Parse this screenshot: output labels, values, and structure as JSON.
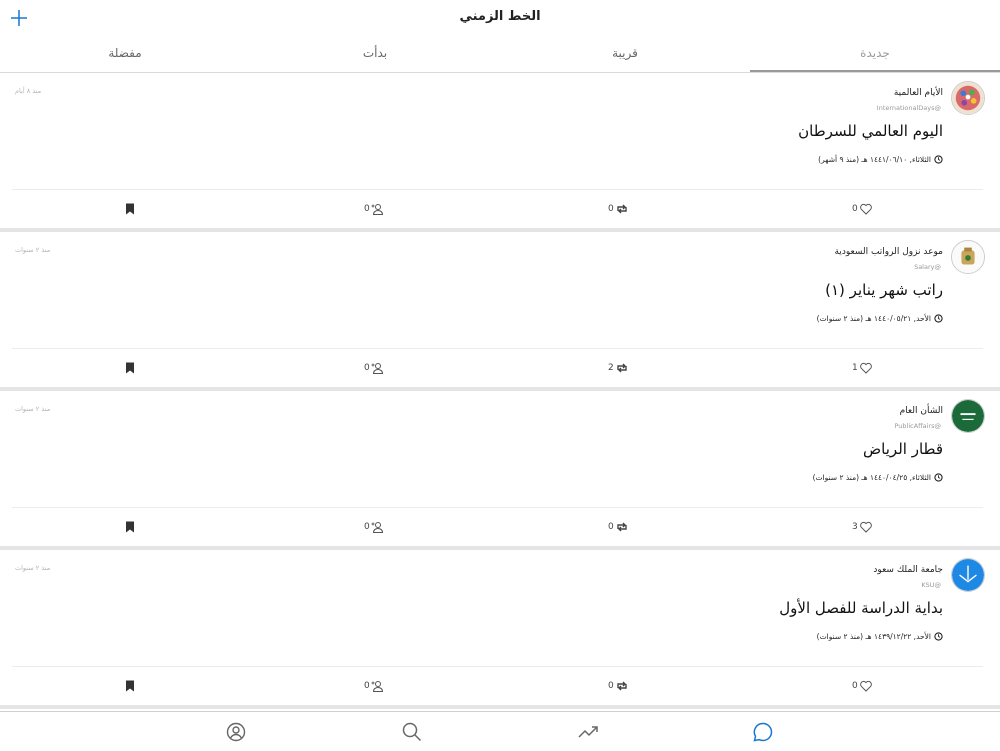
{
  "header": {
    "title": "الخط الزمني",
    "add_icon": "plus-icon"
  },
  "tabs": [
    {
      "label": "جديدة",
      "active": true
    },
    {
      "label": "قريبة",
      "active": false
    },
    {
      "label": "بدأت",
      "active": false
    },
    {
      "label": "مفضلة",
      "active": false
    }
  ],
  "cards": [
    {
      "author": "الأيام العالمية",
      "handle": "InternationalDays@",
      "time_ago": "منذ ٨ أيام",
      "headline": "اليوم العالمي للسرطان",
      "date": "الثلاثاء, ١٤٤١/٠٦/١٠ هـ (منذ ٩ أشهر)",
      "likes": "0",
      "retweets": "0",
      "people": "0"
    },
    {
      "author": "موعد نزول الرواتب السعودية",
      "handle": "Salary@",
      "time_ago": "منذ ٢ سنوات",
      "headline": "راتب شهر يناير (١)",
      "date": "الأحد, ١٤٤٠/٠٥/٢١ هـ (منذ ٢ سنوات)",
      "likes": "1",
      "retweets": "2",
      "people": "0"
    },
    {
      "author": "الشأن العام",
      "handle": "PublicAffairs@",
      "time_ago": "منذ ٢ سنوات",
      "headline": "قطار الرياض",
      "date": "الثلاثاء, ١٤٤٠/٠٤/٢٥ هـ (منذ ٢ سنوات)",
      "likes": "3",
      "retweets": "0",
      "people": "0"
    },
    {
      "author": "جامعة الملك سعود",
      "handle": "KSU@",
      "time_ago": "منذ ٢ سنوات",
      "headline": "بداية الدراسة للفصل الأول",
      "date": "الأحد, ١٤٣٩/١٢/٢٢ هـ (منذ ٢ سنوات)",
      "likes": "0",
      "retweets": "0",
      "people": "0"
    }
  ],
  "bottom_nav": {
    "items": [
      "profile-icon",
      "search-icon",
      "trending-icon",
      "chat-icon"
    ],
    "active": "chat-icon"
  },
  "colors": {
    "accent": "#1976d2",
    "divider": "#e5e5e5"
  }
}
